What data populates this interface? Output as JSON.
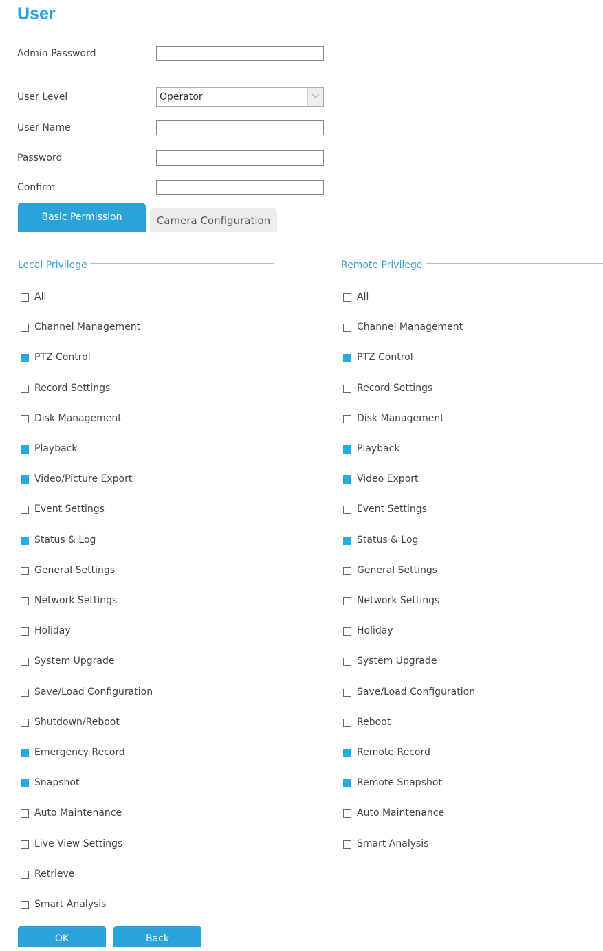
{
  "page": {
    "title": "User"
  },
  "form": {
    "admin_password": {
      "label": "Admin Password",
      "value": ""
    },
    "user_level": {
      "label": "User Level",
      "value": "Operator"
    },
    "user_name": {
      "label": "User Name",
      "value": ""
    },
    "password": {
      "label": "Password",
      "value": ""
    },
    "confirm": {
      "label": "Confirm",
      "value": ""
    }
  },
  "tabs": [
    {
      "label": "Basic Permission",
      "active": true
    },
    {
      "label": "Camera Configuration",
      "active": false
    }
  ],
  "local": {
    "title": "Local Privilege",
    "items": [
      {
        "label": "All",
        "checked": false
      },
      {
        "label": "Channel Management",
        "checked": false
      },
      {
        "label": "PTZ Control",
        "checked": true
      },
      {
        "label": "Record Settings",
        "checked": false
      },
      {
        "label": "Disk Management",
        "checked": false
      },
      {
        "label": "Playback",
        "checked": true
      },
      {
        "label": "Video/Picture Export",
        "checked": true
      },
      {
        "label": "Event Settings",
        "checked": false
      },
      {
        "label": "Status & Log",
        "checked": true
      },
      {
        "label": "General Settings",
        "checked": false
      },
      {
        "label": "Network Settings",
        "checked": false
      },
      {
        "label": "Holiday",
        "checked": false
      },
      {
        "label": "System Upgrade",
        "checked": false
      },
      {
        "label": "Save/Load Configuration",
        "checked": false
      },
      {
        "label": "Shutdown/Reboot",
        "checked": false
      },
      {
        "label": "Emergency Record",
        "checked": true
      },
      {
        "label": "Snapshot",
        "checked": true
      },
      {
        "label": "Auto Maintenance",
        "checked": false
      },
      {
        "label": "Live View Settings",
        "checked": false
      },
      {
        "label": "Retrieve",
        "checked": false
      },
      {
        "label": "Smart Analysis",
        "checked": false
      }
    ]
  },
  "remote": {
    "title": "Remote Privilege",
    "items": [
      {
        "label": "All",
        "checked": false
      },
      {
        "label": "Channel Management",
        "checked": false
      },
      {
        "label": "PTZ Control",
        "checked": true
      },
      {
        "label": "Record Settings",
        "checked": false
      },
      {
        "label": "Disk Management",
        "checked": false
      },
      {
        "label": "Playback",
        "checked": true
      },
      {
        "label": "Video Export",
        "checked": true
      },
      {
        "label": "Event Settings",
        "checked": false
      },
      {
        "label": "Status & Log",
        "checked": true
      },
      {
        "label": "General Settings",
        "checked": false
      },
      {
        "label": "Network Settings",
        "checked": false
      },
      {
        "label": "Holiday",
        "checked": false
      },
      {
        "label": "System Upgrade",
        "checked": false
      },
      {
        "label": "Save/Load Configuration",
        "checked": false
      },
      {
        "label": "Reboot",
        "checked": false
      },
      {
        "label": "Remote Record",
        "checked": true
      },
      {
        "label": "Remote Snapshot",
        "checked": true
      },
      {
        "label": "Auto Maintenance",
        "checked": false
      },
      {
        "label": "Smart Analysis",
        "checked": false
      }
    ]
  },
  "buttons": {
    "ok": "OK",
    "back": "Back"
  },
  "colors": {
    "accent": "#2aa3d9",
    "checked": "#29abe2",
    "section_title": "#3a9fd4"
  }
}
